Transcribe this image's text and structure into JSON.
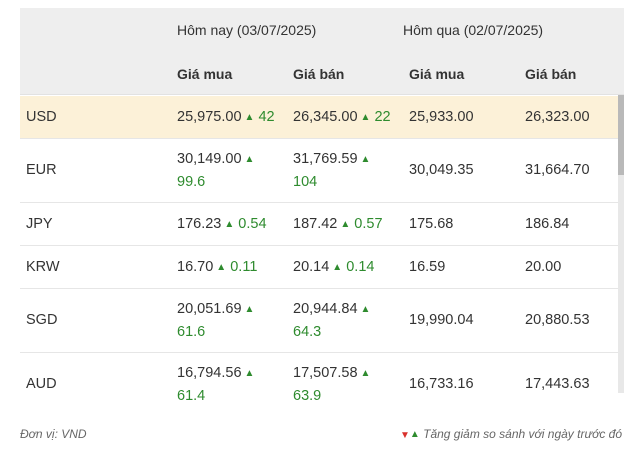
{
  "header": {
    "today": "Hôm nay (03/07/2025)",
    "yesterday": "Hôm qua (02/07/2025)",
    "buy": "Giá mua",
    "sell": "Giá bán"
  },
  "rows": [
    {
      "currency": "USD",
      "buy_today": "25,975.00",
      "buy_change": "42",
      "sell_today": "26,345.00",
      "sell_change": "22",
      "buy_yesterday": "25,933.00",
      "sell_yesterday": "26,323.00"
    },
    {
      "currency": "EUR",
      "buy_today": "30,149.00",
      "buy_change": "99.6",
      "sell_today": "31,769.59",
      "sell_change": "104",
      "buy_yesterday": "30,049.35",
      "sell_yesterday": "31,664.70"
    },
    {
      "currency": "JPY",
      "buy_today": "176.23",
      "buy_change": "0.54",
      "sell_today": "187.42",
      "sell_change": "0.57",
      "buy_yesterday": "175.68",
      "sell_yesterday": "186.84"
    },
    {
      "currency": "KRW",
      "buy_today": "16.70",
      "buy_change": "0.11",
      "sell_today": "20.14",
      "sell_change": "0.14",
      "buy_yesterday": "16.59",
      "sell_yesterday": "20.00"
    },
    {
      "currency": "SGD",
      "buy_today": "20,051.69",
      "buy_change": "61.6",
      "sell_today": "20,944.84",
      "sell_change": "64.3",
      "buy_yesterday": "19,990.04",
      "sell_yesterday": "20,880.53"
    },
    {
      "currency": "AUD",
      "buy_today": "16,794.56",
      "buy_change": "61.4",
      "sell_today": "17,507.58",
      "sell_change": "63.9",
      "buy_yesterday": "16,733.16",
      "sell_yesterday": "17,443.63"
    }
  ],
  "footer": {
    "unit": "Đơn vị: VND",
    "legend": "Tăng giảm so sánh với ngày trước đó"
  },
  "colors": {
    "up": "#2e8b2e",
    "down": "#d9302c",
    "highlight": "#fcf1d8",
    "header_bg": "#eeeeee"
  },
  "icons": {
    "up": "triangle-up-icon",
    "down": "triangle-down-icon"
  }
}
